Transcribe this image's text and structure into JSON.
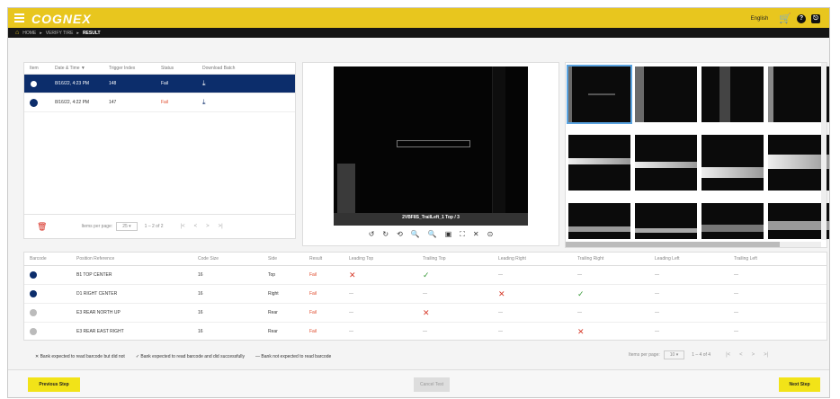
{
  "header": {
    "logo": "COGNEX",
    "lang": "English"
  },
  "breadcrumb": {
    "home": "⌂",
    "items": [
      "HOME",
      "▸",
      "VERIFY TIRE",
      "▸"
    ],
    "current": "RESULT"
  },
  "history": {
    "columns": [
      "Item",
      "Date & Time ▼",
      "Trigger Index",
      "Status",
      "Download Batch"
    ],
    "rows": [
      {
        "date": "8/16/22, 4:23 PM",
        "trigger": "148",
        "status": "Fail",
        "selected": true
      },
      {
        "date": "8/16/22, 4:22 PM",
        "trigger": "147",
        "status": "Fail",
        "selected": false
      }
    ],
    "pager": {
      "label": "Items per page:",
      "size": "25 ▾",
      "range": "1 – 2 of 2",
      "first": "|<",
      "prev": "<",
      "next": ">",
      "last": ">|"
    }
  },
  "viewer": {
    "caption": "2VBF8S_TrailLeft_1 Top / 3",
    "tools": [
      "↺",
      "↻",
      "⟲",
      "🔍",
      "🔍",
      "▣",
      "⛶",
      "✕",
      "⊙"
    ]
  },
  "table": {
    "columns": [
      "Barcode",
      "Position Reference",
      "Code Size",
      "Side",
      "Result",
      "Leading Top",
      "Trailing Top",
      "Leading Right",
      "Trailing Right",
      "Leading Left",
      "Trailing Left"
    ],
    "rows": [
      {
        "ref": "B1 TOP CENTER",
        "size": "16",
        "side": "Top",
        "result": "Fail",
        "c1": "✕",
        "c2": "✓",
        "c3": "—",
        "c4": "—",
        "c5": "—",
        "c6": "—",
        "dot": "blue"
      },
      {
        "ref": "D1 RIGHT CENTER",
        "size": "16",
        "side": "Right",
        "result": "Fail",
        "c1": "—",
        "c2": "—",
        "c3": "✕",
        "c4": "✓",
        "c5": "—",
        "c6": "—",
        "dot": "blue"
      },
      {
        "ref": "E3 REAR NORTH UP",
        "size": "16",
        "side": "Rear",
        "result": "Fail",
        "c1": "—",
        "c2": "✕",
        "c3": "—",
        "c4": "—",
        "c5": "—",
        "c6": "—",
        "dot": "grey"
      },
      {
        "ref": "E3 REAR EAST RIGHT",
        "size": "16",
        "side": "Rear",
        "result": "Fail",
        "c1": "—",
        "c2": "—",
        "c3": "—",
        "c4": "✕",
        "c5": "—",
        "c6": "—",
        "dot": "grey"
      }
    ]
  },
  "legend": {
    "fail": "✕ Bank expected to read barcode but did not",
    "pass": "✓ Bank expected to read barcode and did successfully",
    "na": "— Bank not expected to read barcode"
  },
  "table_pager": {
    "label": "Items per page:",
    "size": "10 ▾",
    "range": "1 – 4 of 4",
    "first": "|<",
    "prev": "<",
    "next": ">",
    "last": ">|"
  },
  "footer": {
    "prev": "Previous Step",
    "middle": "Cancel Test",
    "next": "Next Step"
  }
}
